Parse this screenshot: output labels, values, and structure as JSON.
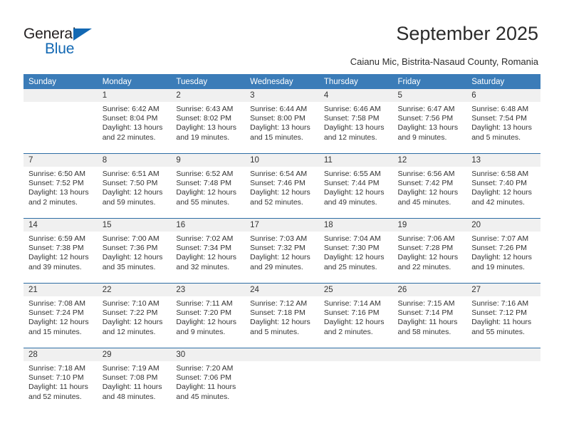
{
  "brand": {
    "name_top": "General",
    "name_bottom": "Blue",
    "triangle_icon": "triangle-icon",
    "color_dark": "#231f20",
    "color_blue": "#1268b3"
  },
  "header": {
    "title": "September 2025",
    "subtitle": "Caianu Mic, Bistrita-Nasaud County, Romania"
  },
  "calendar": {
    "accent_color": "#3b7cb8",
    "separator_color": "#2e6da4",
    "daynum_band_color": "#f0f0f0",
    "weekday_headers": [
      "Sunday",
      "Monday",
      "Tuesday",
      "Wednesday",
      "Thursday",
      "Friday",
      "Saturday"
    ],
    "weeks": [
      [
        {
          "day": "",
          "sunrise": "",
          "sunset": "",
          "daylight_line1": "",
          "daylight_line2": ""
        },
        {
          "day": "1",
          "sunrise": "Sunrise: 6:42 AM",
          "sunset": "Sunset: 8:04 PM",
          "daylight_line1": "Daylight: 13 hours",
          "daylight_line2": "and 22 minutes."
        },
        {
          "day": "2",
          "sunrise": "Sunrise: 6:43 AM",
          "sunset": "Sunset: 8:02 PM",
          "daylight_line1": "Daylight: 13 hours",
          "daylight_line2": "and 19 minutes."
        },
        {
          "day": "3",
          "sunrise": "Sunrise: 6:44 AM",
          "sunset": "Sunset: 8:00 PM",
          "daylight_line1": "Daylight: 13 hours",
          "daylight_line2": "and 15 minutes."
        },
        {
          "day": "4",
          "sunrise": "Sunrise: 6:46 AM",
          "sunset": "Sunset: 7:58 PM",
          "daylight_line1": "Daylight: 13 hours",
          "daylight_line2": "and 12 minutes."
        },
        {
          "day": "5",
          "sunrise": "Sunrise: 6:47 AM",
          "sunset": "Sunset: 7:56 PM",
          "daylight_line1": "Daylight: 13 hours",
          "daylight_line2": "and 9 minutes."
        },
        {
          "day": "6",
          "sunrise": "Sunrise: 6:48 AM",
          "sunset": "Sunset: 7:54 PM",
          "daylight_line1": "Daylight: 13 hours",
          "daylight_line2": "and 5 minutes."
        }
      ],
      [
        {
          "day": "7",
          "sunrise": "Sunrise: 6:50 AM",
          "sunset": "Sunset: 7:52 PM",
          "daylight_line1": "Daylight: 13 hours",
          "daylight_line2": "and 2 minutes."
        },
        {
          "day": "8",
          "sunrise": "Sunrise: 6:51 AM",
          "sunset": "Sunset: 7:50 PM",
          "daylight_line1": "Daylight: 12 hours",
          "daylight_line2": "and 59 minutes."
        },
        {
          "day": "9",
          "sunrise": "Sunrise: 6:52 AM",
          "sunset": "Sunset: 7:48 PM",
          "daylight_line1": "Daylight: 12 hours",
          "daylight_line2": "and 55 minutes."
        },
        {
          "day": "10",
          "sunrise": "Sunrise: 6:54 AM",
          "sunset": "Sunset: 7:46 PM",
          "daylight_line1": "Daylight: 12 hours",
          "daylight_line2": "and 52 minutes."
        },
        {
          "day": "11",
          "sunrise": "Sunrise: 6:55 AM",
          "sunset": "Sunset: 7:44 PM",
          "daylight_line1": "Daylight: 12 hours",
          "daylight_line2": "and 49 minutes."
        },
        {
          "day": "12",
          "sunrise": "Sunrise: 6:56 AM",
          "sunset": "Sunset: 7:42 PM",
          "daylight_line1": "Daylight: 12 hours",
          "daylight_line2": "and 45 minutes."
        },
        {
          "day": "13",
          "sunrise": "Sunrise: 6:58 AM",
          "sunset": "Sunset: 7:40 PM",
          "daylight_line1": "Daylight: 12 hours",
          "daylight_line2": "and 42 minutes."
        }
      ],
      [
        {
          "day": "14",
          "sunrise": "Sunrise: 6:59 AM",
          "sunset": "Sunset: 7:38 PM",
          "daylight_line1": "Daylight: 12 hours",
          "daylight_line2": "and 39 minutes."
        },
        {
          "day": "15",
          "sunrise": "Sunrise: 7:00 AM",
          "sunset": "Sunset: 7:36 PM",
          "daylight_line1": "Daylight: 12 hours",
          "daylight_line2": "and 35 minutes."
        },
        {
          "day": "16",
          "sunrise": "Sunrise: 7:02 AM",
          "sunset": "Sunset: 7:34 PM",
          "daylight_line1": "Daylight: 12 hours",
          "daylight_line2": "and 32 minutes."
        },
        {
          "day": "17",
          "sunrise": "Sunrise: 7:03 AM",
          "sunset": "Sunset: 7:32 PM",
          "daylight_line1": "Daylight: 12 hours",
          "daylight_line2": "and 29 minutes."
        },
        {
          "day": "18",
          "sunrise": "Sunrise: 7:04 AM",
          "sunset": "Sunset: 7:30 PM",
          "daylight_line1": "Daylight: 12 hours",
          "daylight_line2": "and 25 minutes."
        },
        {
          "day": "19",
          "sunrise": "Sunrise: 7:06 AM",
          "sunset": "Sunset: 7:28 PM",
          "daylight_line1": "Daylight: 12 hours",
          "daylight_line2": "and 22 minutes."
        },
        {
          "day": "20",
          "sunrise": "Sunrise: 7:07 AM",
          "sunset": "Sunset: 7:26 PM",
          "daylight_line1": "Daylight: 12 hours",
          "daylight_line2": "and 19 minutes."
        }
      ],
      [
        {
          "day": "21",
          "sunrise": "Sunrise: 7:08 AM",
          "sunset": "Sunset: 7:24 PM",
          "daylight_line1": "Daylight: 12 hours",
          "daylight_line2": "and 15 minutes."
        },
        {
          "day": "22",
          "sunrise": "Sunrise: 7:10 AM",
          "sunset": "Sunset: 7:22 PM",
          "daylight_line1": "Daylight: 12 hours",
          "daylight_line2": "and 12 minutes."
        },
        {
          "day": "23",
          "sunrise": "Sunrise: 7:11 AM",
          "sunset": "Sunset: 7:20 PM",
          "daylight_line1": "Daylight: 12 hours",
          "daylight_line2": "and 9 minutes."
        },
        {
          "day": "24",
          "sunrise": "Sunrise: 7:12 AM",
          "sunset": "Sunset: 7:18 PM",
          "daylight_line1": "Daylight: 12 hours",
          "daylight_line2": "and 5 minutes."
        },
        {
          "day": "25",
          "sunrise": "Sunrise: 7:14 AM",
          "sunset": "Sunset: 7:16 PM",
          "daylight_line1": "Daylight: 12 hours",
          "daylight_line2": "and 2 minutes."
        },
        {
          "day": "26",
          "sunrise": "Sunrise: 7:15 AM",
          "sunset": "Sunset: 7:14 PM",
          "daylight_line1": "Daylight: 11 hours",
          "daylight_line2": "and 58 minutes."
        },
        {
          "day": "27",
          "sunrise": "Sunrise: 7:16 AM",
          "sunset": "Sunset: 7:12 PM",
          "daylight_line1": "Daylight: 11 hours",
          "daylight_line2": "and 55 minutes."
        }
      ],
      [
        {
          "day": "28",
          "sunrise": "Sunrise: 7:18 AM",
          "sunset": "Sunset: 7:10 PM",
          "daylight_line1": "Daylight: 11 hours",
          "daylight_line2": "and 52 minutes."
        },
        {
          "day": "29",
          "sunrise": "Sunrise: 7:19 AM",
          "sunset": "Sunset: 7:08 PM",
          "daylight_line1": "Daylight: 11 hours",
          "daylight_line2": "and 48 minutes."
        },
        {
          "day": "30",
          "sunrise": "Sunrise: 7:20 AM",
          "sunset": "Sunset: 7:06 PM",
          "daylight_line1": "Daylight: 11 hours",
          "daylight_line2": "and 45 minutes."
        },
        {
          "day": "",
          "sunrise": "",
          "sunset": "",
          "daylight_line1": "",
          "daylight_line2": ""
        },
        {
          "day": "",
          "sunrise": "",
          "sunset": "",
          "daylight_line1": "",
          "daylight_line2": ""
        },
        {
          "day": "",
          "sunrise": "",
          "sunset": "",
          "daylight_line1": "",
          "daylight_line2": ""
        },
        {
          "day": "",
          "sunrise": "",
          "sunset": "",
          "daylight_line1": "",
          "daylight_line2": ""
        }
      ]
    ]
  }
}
